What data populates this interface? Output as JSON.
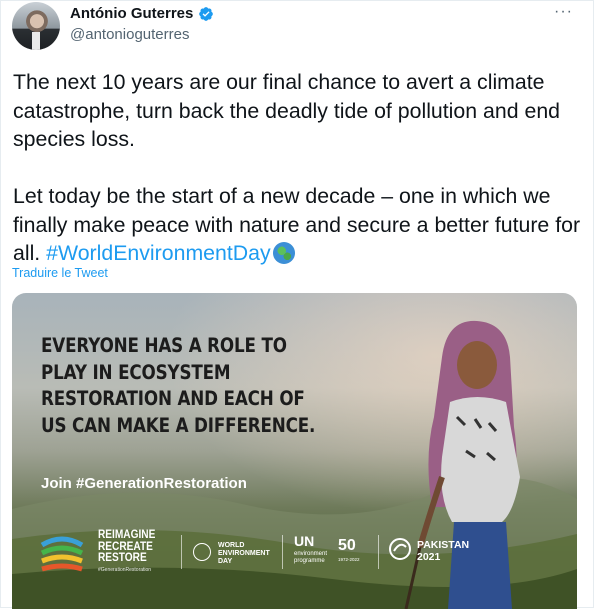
{
  "author": {
    "name": "António Guterres",
    "handle": "@antonioguterres",
    "verified": true,
    "more_label": "···"
  },
  "tweet": {
    "text_main": "The next 10 years are our final chance to avert a climate catastrophe, turn back the deadly tide of pollution and end species loss.\n\nLet today be the start of a new decade – one in which we finally make peace with nature and secure a better future for all. ",
    "hashtag": "#WorldEnvironmentDay",
    "emoji": "globe-icon",
    "translate_label": "Traduire le Tweet"
  },
  "media": {
    "headline": "EVERYONE HAS A ROLE TO PLAY IN ECOSYSTEM RESTORATION AND EACH OF US CAN MAKE A DIFFERENCE.",
    "join_text": "Join #GenerationRestoration",
    "logos": {
      "rrr": "REIMAGINE\nRECREATE\nRESTORE",
      "rrr_tag": "#GenerationRestoration",
      "wed": "WORLD\nENVIRONMENT\nDAY",
      "un": "UN",
      "un_sub": "environment\nprogramme",
      "fifty": "50",
      "fifty_sub": "1972-2022",
      "host": "PAKISTAN\n2021"
    }
  },
  "colors": {
    "accent": "#1d9bf0",
    "text": "#0f1419",
    "secondary": "#536471"
  }
}
